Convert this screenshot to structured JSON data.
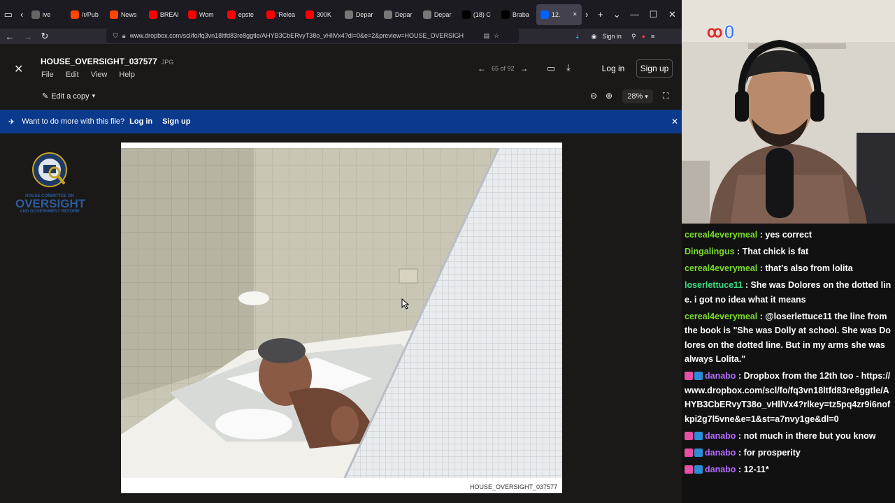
{
  "browser": {
    "tabs": [
      {
        "label": "ive",
        "color": "#666"
      },
      {
        "label": "/r/Pub",
        "color": "#ff4500"
      },
      {
        "label": "News",
        "color": "#ff4500"
      },
      {
        "label": "BREAK",
        "color": "#ff0000"
      },
      {
        "label": "Wom",
        "color": "#ff0000"
      },
      {
        "label": "epste",
        "color": "#ff0000"
      },
      {
        "label": "'Relea",
        "color": "#ff0000"
      },
      {
        "label": "300K",
        "color": "#ff0000"
      },
      {
        "label": "Depar",
        "color": "#777"
      },
      {
        "label": "Depar",
        "color": "#777"
      },
      {
        "label": "Depar",
        "color": "#777"
      },
      {
        "label": "(18) C",
        "color": "#000"
      },
      {
        "label": "Braba",
        "color": "#000"
      },
      {
        "label": "12.",
        "color": "#0061fe"
      }
    ],
    "url": "www.dropbox.com/scl/fo/fq3vn18ltfd83re8ggtle/AHYB3CbERvyT38o_vHllVx4?dl=0&e=2&preview=HOUSE_OVERSIGH",
    "sign_in": "Sign in"
  },
  "viewer": {
    "filename": "HOUSE_OVERSIGHT_037577",
    "filetype": "JPG",
    "menu": [
      "File",
      "Edit",
      "View",
      "Help"
    ],
    "edit_copy": "Edit a copy",
    "pager": "65 of 92",
    "login": "Log in",
    "signup": "Sign up",
    "zoom": "28%",
    "banner": {
      "text": "Want to do more with this file?",
      "login": "Log in",
      "signup": "Sign up"
    },
    "caption": "HOUSE_OVERSIGHT_037577",
    "logo": {
      "arc_text": "OVERSIGHT · TRANSPARENCY · ACCOUNTABILITY",
      "line1": "HOUSE COMMITTEE ON",
      "line2": "OVERSIGHT",
      "line3": "AND GOVERNMENT REFORM"
    }
  },
  "stream": {
    "counter": "0",
    "chat": [
      {
        "user": "cereal4everymeal",
        "color": "#7bdc2a",
        "text": ": yes correct",
        "badges": []
      },
      {
        "user": "Dingalingus",
        "color": "#7bdc2a",
        "text": ": That chick is fat",
        "badges": []
      },
      {
        "user": "cereal4everymeal",
        "color": "#7bdc2a",
        "text": ": that's also from lolita",
        "badges": []
      },
      {
        "user": "loserlettuce11",
        "color": "#3ddc84",
        "text": ": She was Dolores on the dotted line. i got no idea what it means",
        "badges": []
      },
      {
        "user": "cereal4everymeal",
        "color": "#7bdc2a",
        "text": ": @loserlettuce11 the line from the book is \"She was Dolly at school. She was Dolores on the dotted line. But in my arms she was always Lolita.\"",
        "badges": []
      },
      {
        "user": "danabo",
        "color": "#b36bff",
        "text": ": Dropbox from the 12th too - https://www.dropbox.com/scl/fo/fq3vn18ltfd83re8ggtle/AHYB3CbERvyT38o_vHllVx4?rlkey=tz5pq4zr9i6nofkpi2g7l5vne&e=1&st=a7nvy1ge&dl=0",
        "badges": [
          "#e84ea1",
          "#2c8dd6"
        ]
      },
      {
        "user": "danabo",
        "color": "#b36bff",
        "text": ": not much in there but you know",
        "badges": [
          "#e84ea1",
          "#2c8dd6"
        ]
      },
      {
        "user": "danabo",
        "color": "#b36bff",
        "text": ": for prosperity",
        "badges": [
          "#e84ea1",
          "#2c8dd6"
        ]
      },
      {
        "user": "danabo",
        "color": "#b36bff",
        "text": ": 12-11*",
        "badges": [
          "#e84ea1",
          "#2c8dd6"
        ]
      }
    ]
  }
}
